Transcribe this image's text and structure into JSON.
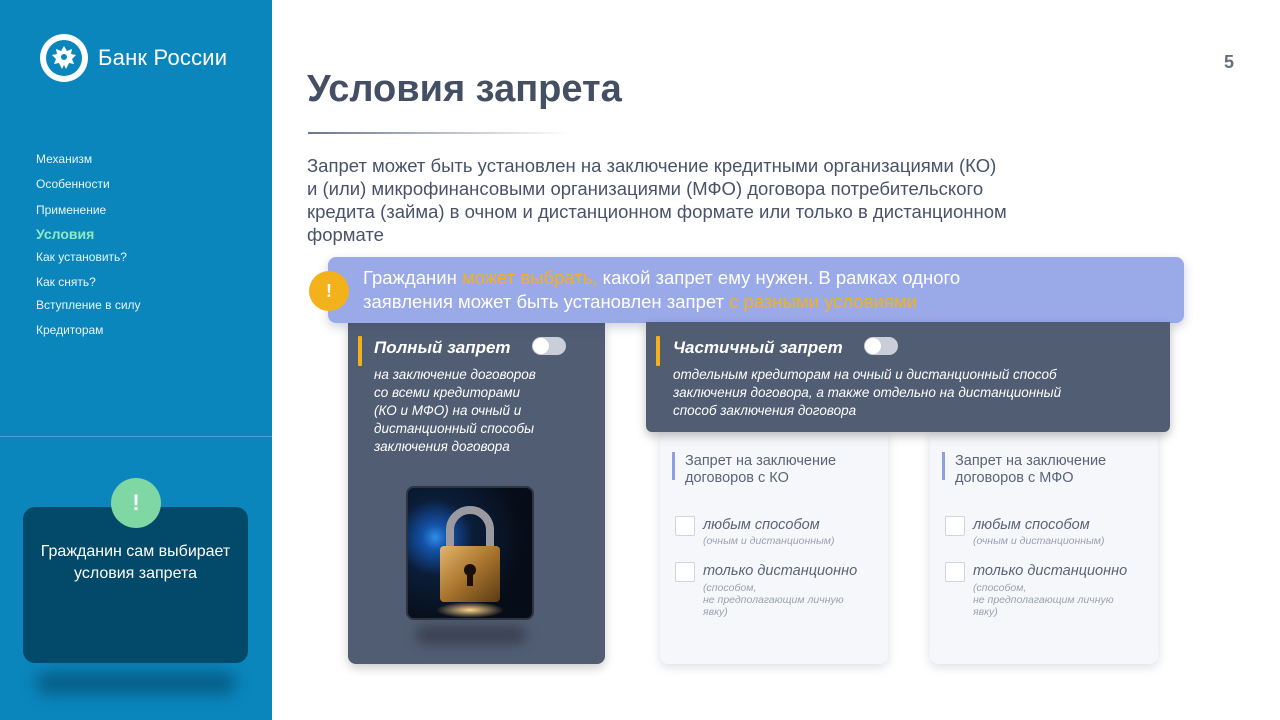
{
  "brand": {
    "name": "Банк России"
  },
  "page_number": "5",
  "sidebar": {
    "nav": [
      {
        "label": "Механизм",
        "active": false
      },
      {
        "label": "Особенности",
        "active": false
      },
      {
        "label": "Применение",
        "active": false
      },
      {
        "label": "Условия",
        "active": true
      },
      {
        "label": "Как установить?",
        "active": false
      },
      {
        "label": "Как снять?",
        "active": false
      },
      {
        "label": "Вступление в силу",
        "active": false
      },
      {
        "label": "Кредиторам",
        "active": false
      }
    ],
    "callout": {
      "badge": "!",
      "text_line1": "Гражданин сам выбирает",
      "text_line2": "условия запрета"
    }
  },
  "main": {
    "title": "Условия запрета",
    "intro": {
      "line1": "Запрет может быть установлен на заключение кредитными организациями (КО)",
      "line2": "и (или) микрофинансовыми организациями (МФО) договора потребительского",
      "line3": "кредита (займа) в очном и дистанционном формате или только в дистанционном",
      "line4": "формате"
    },
    "banner": {
      "badge": "!",
      "part1": "Гражданин ",
      "highlight1": "может выбрать,",
      "part2": " какой запрет ему нужен. В рамках одного",
      "part3": "заявления может быть установлен запрет ",
      "highlight2": "с разными условиями"
    },
    "full_ban": {
      "title": "Полный запрет",
      "toggle_on": false,
      "desc": {
        "line1": "на заключение договоров",
        "line2": "со всеми кредиторами",
        "line3": "(КО и МФО) на очный и",
        "line4": "дистанционный способы",
        "line5": "заключения договора"
      }
    },
    "partial_ban": {
      "title": "Частичный запрет",
      "toggle_on": false,
      "desc": {
        "line1": "отдельным кредиторам на очный и дистанционный способ",
        "line2": "заключения договора, а также отдельно на дистанционный",
        "line3": "способ заключения договора"
      }
    },
    "ko_card": {
      "title_line1": "Запрет на заключение",
      "title_line2": "договоров с КО",
      "opt1_label": "любым способом",
      "opt1_note": "(очным и дистанционным)",
      "opt2_label": "только дистанционно",
      "opt2_note1": "(способом,",
      "opt2_note2": "не предполагающим личную",
      "opt2_note3": "явку)"
    },
    "mfo_card": {
      "title_line1": "Запрет на заключение",
      "title_line2": "договоров с МФО",
      "opt1_label": "любым способом",
      "opt1_note": "(очным и дистанционным)",
      "opt2_label": "только дистанционно",
      "opt2_note1": "(способом,",
      "opt2_note2": "не предполагающим личную",
      "opt2_note3": "явку)"
    },
    "colors": {
      "sidebar": "#0a86bd",
      "accent_yellow": "#f3b11b",
      "banner": "#9aa9e8",
      "card_dark": "#515d73",
      "active_nav": "#8ee9c3",
      "badge_green": "#7fd8a3"
    },
    "image": {
      "icon": "padlock-image"
    }
  }
}
